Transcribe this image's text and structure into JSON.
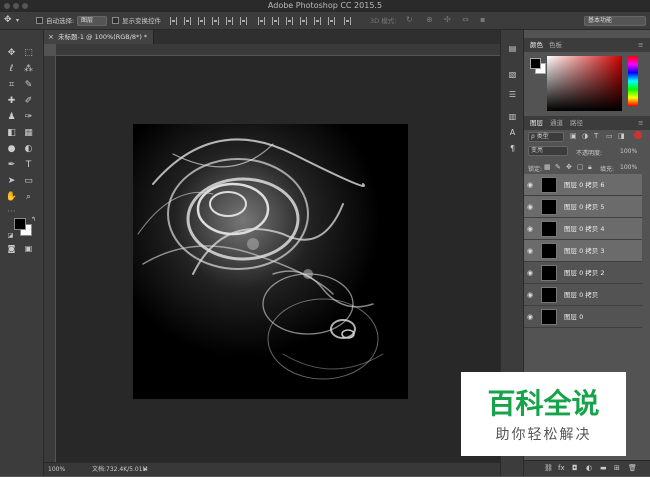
{
  "app": {
    "title": "Adobe Photoshop CC 2015.5"
  },
  "options_bar": {
    "auto_select_label": "自动选择:",
    "auto_select_value": "图层",
    "show_transform_label": "显示变换控件",
    "mode_3d_label": "3D 模式:",
    "workspace": "基本功能"
  },
  "document": {
    "tab_title": "未标题-1 @ 100%(RGB/8*) *"
  },
  "status": {
    "zoom": "100%",
    "doc_info": "文档:732.4K/5.01M"
  },
  "color_panel": {
    "tabs": [
      "颜色",
      "色板"
    ],
    "accent": "#b01818"
  },
  "layers_panel": {
    "tabs": [
      "图层",
      "通道",
      "路径"
    ],
    "filter_label": "ρ 类型",
    "blend_mode": "变亮",
    "opacity_label": "不透明度:",
    "opacity_value": "100%",
    "lock_label": "锁定:",
    "fill_label": "填充:",
    "fill_value": "100%",
    "layers": [
      {
        "name": "图层 0 拷贝 6",
        "selected": true
      },
      {
        "name": "图层 0 拷贝 5",
        "selected": true
      },
      {
        "name": "图层 0 拷贝 4",
        "selected": true
      },
      {
        "name": "图层 0 拷贝 3",
        "selected": true
      },
      {
        "name": "图层 0 拷贝 2",
        "selected": false
      },
      {
        "name": "图层 0 拷贝",
        "selected": false
      },
      {
        "name": "图层 0",
        "selected": false
      }
    ]
  },
  "watermark": {
    "title": "百科全说",
    "subtitle": "助你轻松解决"
  }
}
